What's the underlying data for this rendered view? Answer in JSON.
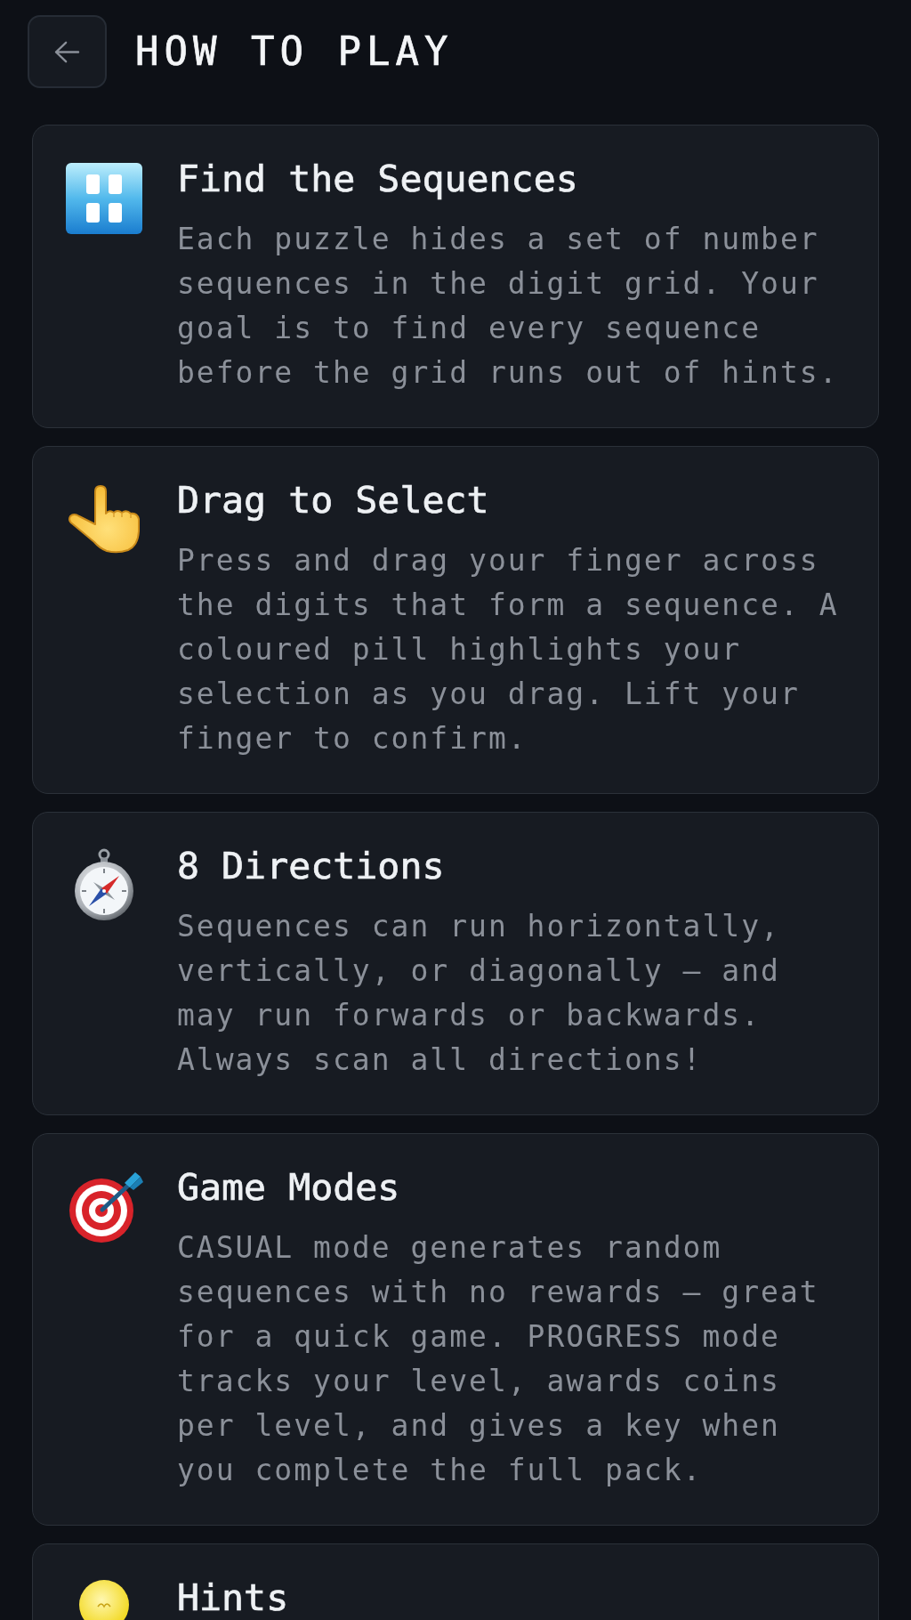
{
  "header": {
    "title": "HOW TO PLAY"
  },
  "cards": [
    {
      "kind": "numbers",
      "title": "Find the Sequences",
      "body": "Each puzzle hides a set of number sequences in the digit grid. Your goal is to find every sequence before the grid runs out of hints."
    },
    {
      "kind": "hand",
      "title": "Drag to Select",
      "body": "Press and drag your finger across the digits that form a sequence. A coloured pill highlights your selection as you drag. Lift your finger to confirm."
    },
    {
      "kind": "compass",
      "title": "8 Directions",
      "body": "Sequences can run horizontally, vertically, or diagonally — and may run forwards or backwards. Always scan all directions!"
    },
    {
      "kind": "target",
      "title": "Game Modes",
      "body": "CASUAL mode generates random sequences with no rewards — great for a quick game. PROGRESS mode tracks your level, awards coins per level, and gives a key when you complete the full pack."
    },
    {
      "kind": "bulb",
      "title": "Hints"
    }
  ]
}
